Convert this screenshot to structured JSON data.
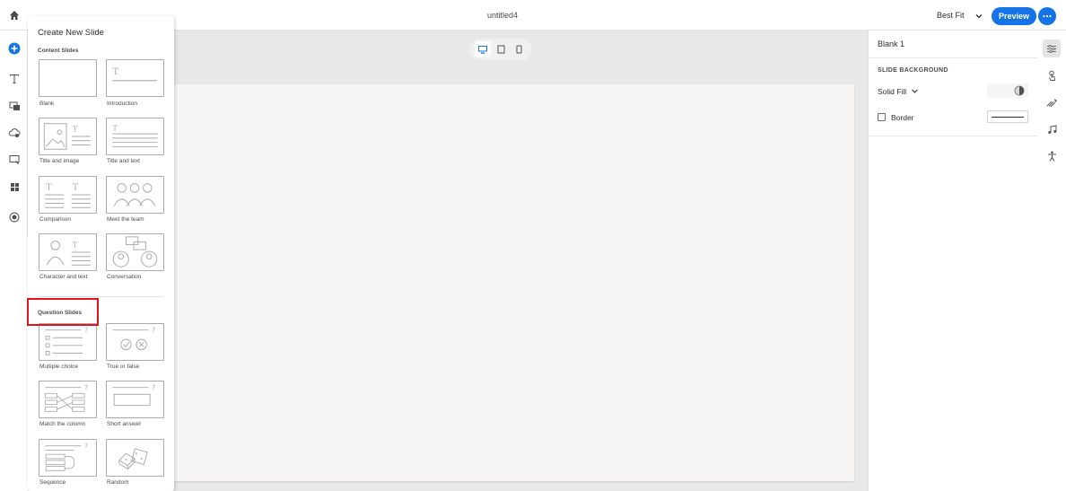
{
  "topbar": {
    "home_icon": "home-icon",
    "document_title": "untitled4",
    "fit_label": "Best Fit",
    "preview_label": "Preview",
    "more_icon": "ellipsis-icon",
    "accent_color": "#1473e6"
  },
  "left_rail": {
    "items": [
      {
        "name": "add",
        "icon": "plus-circle-icon"
      },
      {
        "name": "text",
        "icon": "text-icon"
      },
      {
        "name": "media",
        "icon": "media-icon"
      },
      {
        "name": "assets",
        "icon": "cloud-icon"
      },
      {
        "name": "interactions",
        "icon": "interaction-icon"
      },
      {
        "name": "widgets",
        "icon": "grid-icon"
      },
      {
        "name": "record",
        "icon": "record-icon"
      }
    ]
  },
  "create_panel": {
    "title": "Create New Slide",
    "content_section": "Content Slides",
    "question_section": "Question Slides",
    "content_tiles": [
      {
        "label": "Blank"
      },
      {
        "label": "Introduction"
      },
      {
        "label": "Title and image"
      },
      {
        "label": "Title and text"
      },
      {
        "label": "Comparison"
      },
      {
        "label": "Meet the team"
      },
      {
        "label": "Character and text"
      },
      {
        "label": "Conversation"
      }
    ],
    "question_tiles": [
      {
        "label": "Multiple choice"
      },
      {
        "label": "True or false"
      },
      {
        "label": "Match the column"
      },
      {
        "label": "Short answer"
      },
      {
        "label": "Sequence"
      },
      {
        "label": "Random"
      }
    ],
    "highlight_color": "#e4141c"
  },
  "canvas": {
    "device_modes": [
      "desktop-icon",
      "tablet-icon",
      "mobile-icon"
    ],
    "active_device": "desktop",
    "slide_color": "#f6f5f3"
  },
  "properties": {
    "title": "Blank 1",
    "section": "SLIDE BACKGROUND",
    "fill_type": "Solid Fill",
    "border_label": "Border",
    "border_checked": false
  },
  "right_rail": {
    "items": [
      {
        "name": "properties",
        "icon": "sliders-icon",
        "active": true
      },
      {
        "name": "interactions",
        "icon": "touch-icon"
      },
      {
        "name": "animations",
        "icon": "animation-icon"
      },
      {
        "name": "audio",
        "icon": "music-icon"
      },
      {
        "name": "accessibility",
        "icon": "accessibility-icon"
      }
    ]
  }
}
